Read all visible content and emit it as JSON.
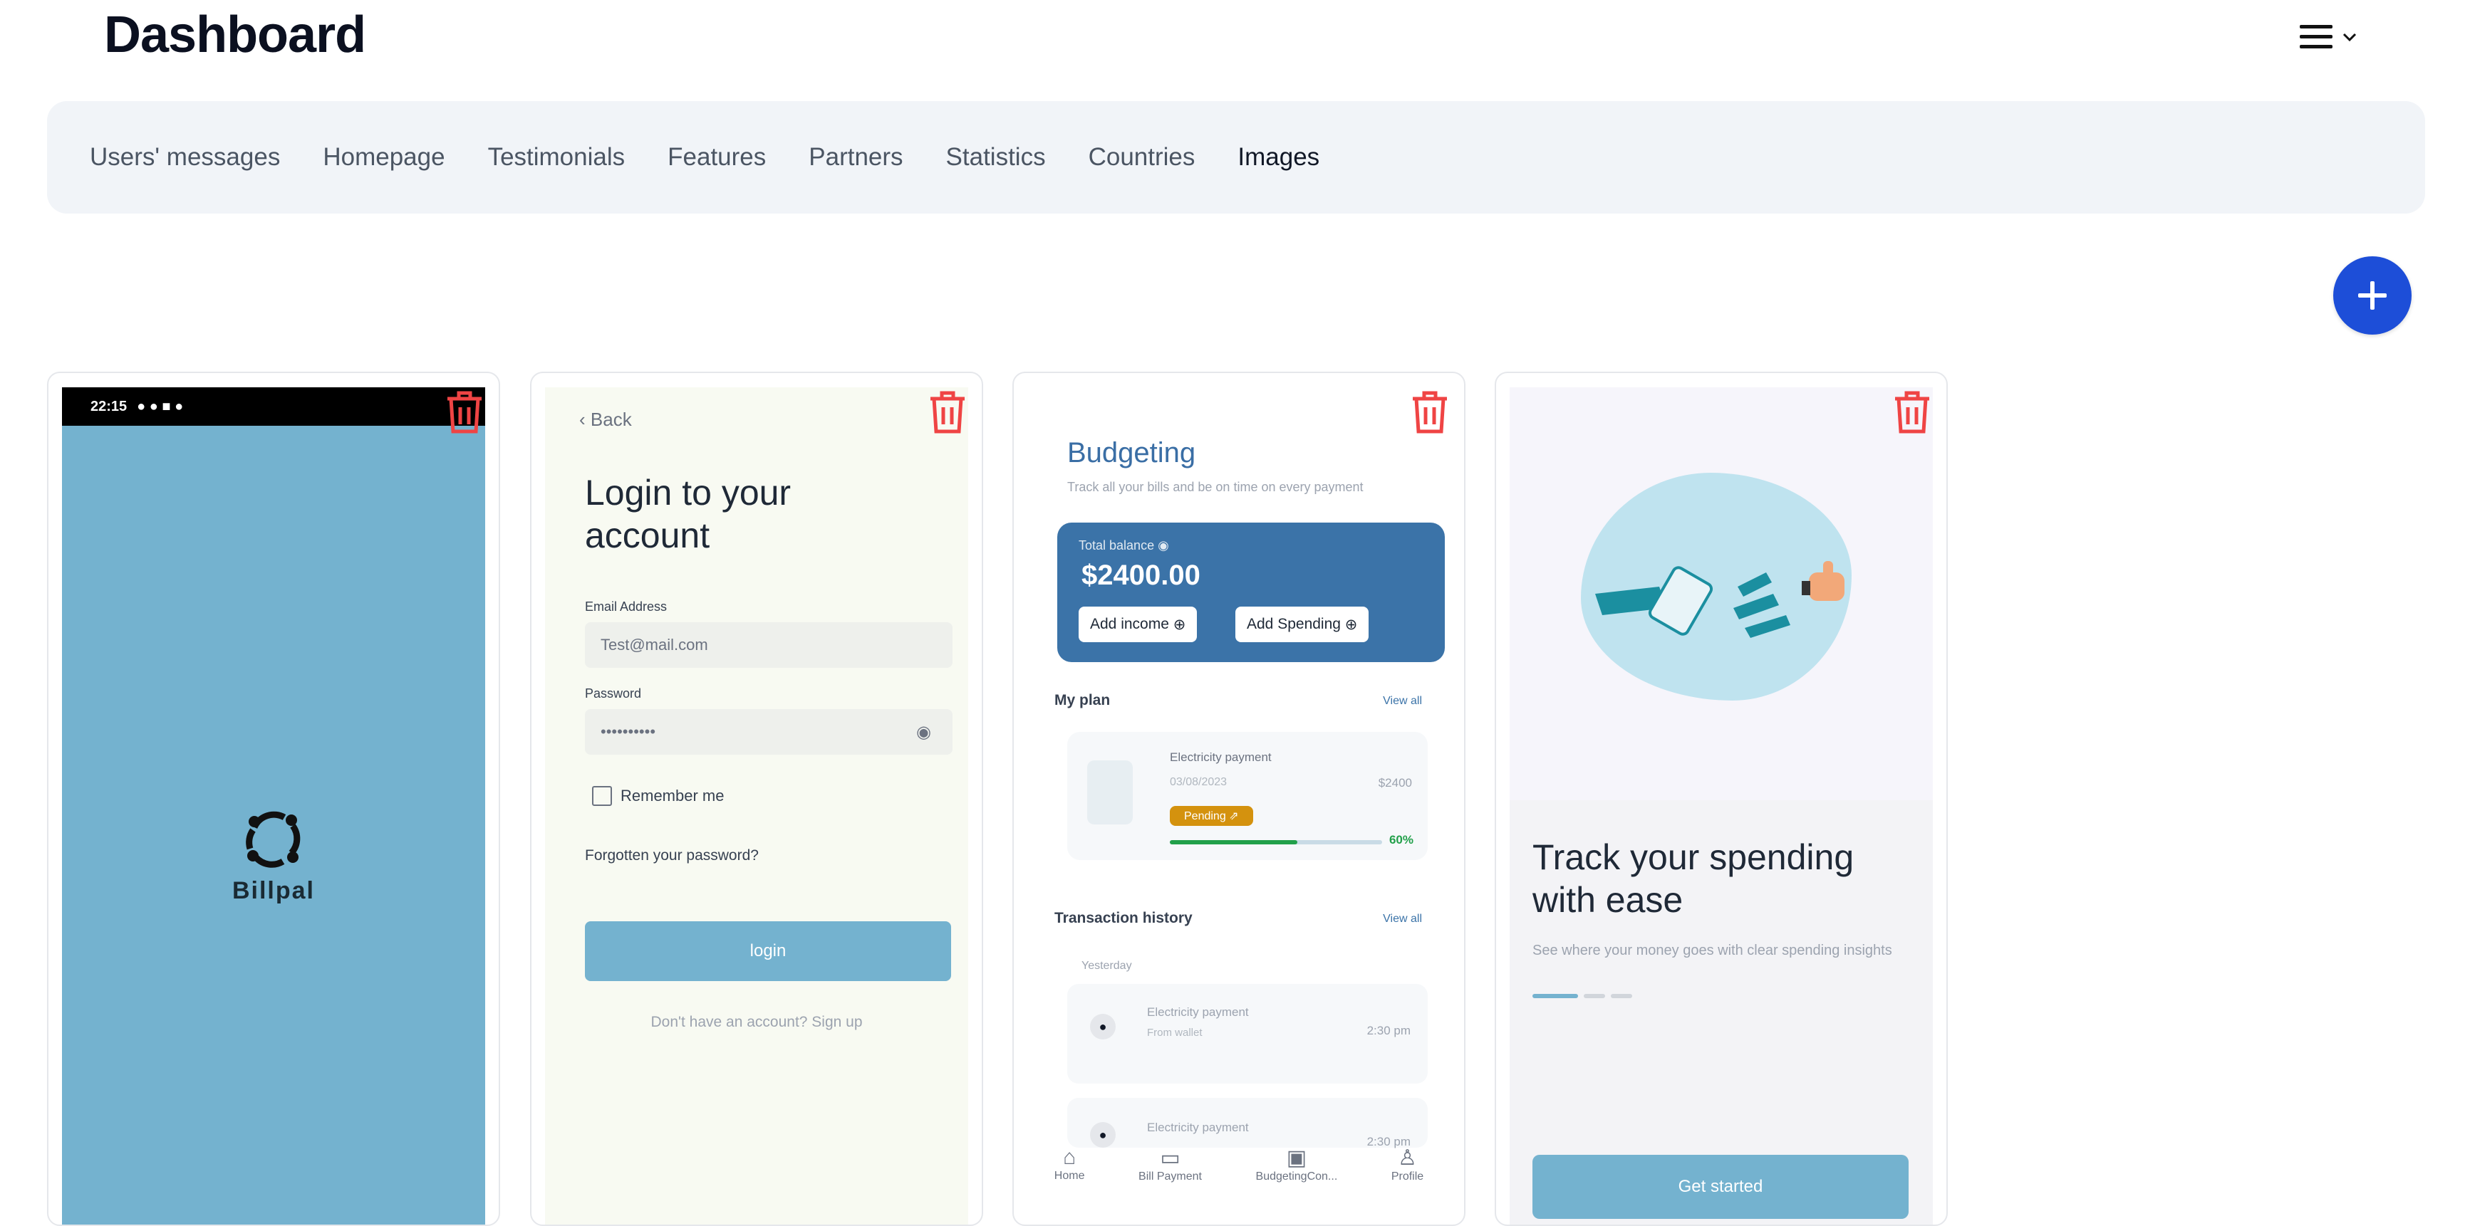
{
  "header": {
    "title": "Dashboard"
  },
  "tabs": [
    {
      "label": "Users' messages",
      "active": false
    },
    {
      "label": "Homepage",
      "active": false
    },
    {
      "label": "Testimonials",
      "active": false
    },
    {
      "label": "Features",
      "active": false
    },
    {
      "label": "Partners",
      "active": false
    },
    {
      "label": "Statistics",
      "active": false
    },
    {
      "label": "Countries",
      "active": false
    },
    {
      "label": "Images",
      "active": true
    }
  ],
  "icons": {
    "menu": "hamburger-menu-icon",
    "add": "plus-icon",
    "delete": "trash-icon"
  },
  "colors": {
    "accent": "#1d4ed8",
    "delete": "#ef4444",
    "app_blue": "#74b2cf"
  },
  "cards": [
    {
      "splash": {
        "time": "22:15",
        "brand": "Billpal"
      }
    },
    {
      "login": {
        "back": "Back",
        "title": "Login to your account",
        "email_label": "Email Address",
        "email_value": "Test@mail.com",
        "password_label": "Password",
        "password_value": "••••••••••",
        "remember": "Remember me",
        "forgot": "Forgotten your password?",
        "button": "login",
        "signup": "Don't have an account? Sign up"
      }
    },
    {
      "budget": {
        "title": "Budgeting",
        "subtitle": "Track all your bills and be on time on every payment",
        "total_label": "Total balance",
        "total": "$2400.00",
        "add_income": "Add income",
        "add_spending": "Add Spending",
        "my_plan": "My plan",
        "view_all_1": "View all",
        "plan_name": "Electricity payment",
        "plan_date": "03/08/2023",
        "plan_amount": "$2400",
        "plan_status": "Pending",
        "plan_progress": "60%",
        "history": "Transaction history",
        "view_all_2": "View all",
        "yesterday": "Yesterday",
        "tx1_name": "Electricity payment",
        "tx1_from": "From wallet",
        "tx1_time": "2:30 pm",
        "tx2_name": "Electricity payment",
        "tx2_time": "2:30 pm",
        "nav": [
          "Home",
          "Bill Payment",
          "BudgetingCon...",
          "Profile"
        ]
      }
    },
    {
      "onboard": {
        "title": "Track your spending with ease",
        "subtitle": "See where your money goes with clear spending insights",
        "button": "Get started"
      }
    }
  ]
}
